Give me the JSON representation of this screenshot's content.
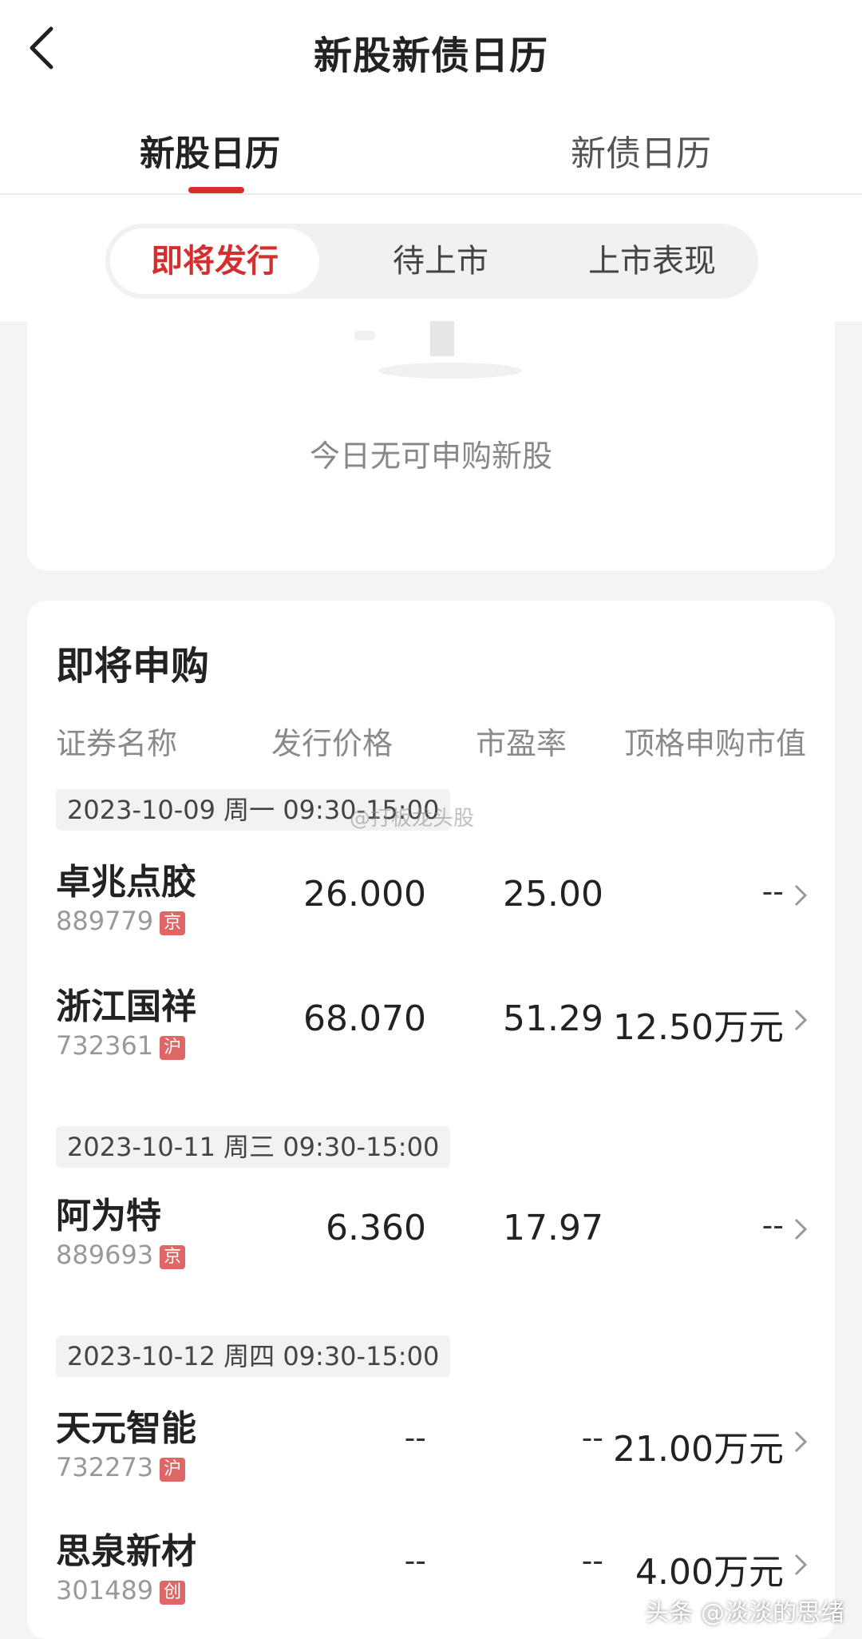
{
  "header": {
    "title": "新股新债日历"
  },
  "tabs": [
    {
      "label": "新股日历"
    },
    {
      "label": "新债日历"
    }
  ],
  "segments": [
    {
      "label": "即将发行"
    },
    {
      "label": "待上市"
    },
    {
      "label": "上市表现"
    }
  ],
  "empty": {
    "text": "今日无可申购新股"
  },
  "section": {
    "title": "即将申购",
    "columns": [
      "证券名称",
      "发行价格",
      "市盈率",
      "顶格申购市值"
    ]
  },
  "groups": [
    {
      "date": "2023-10-09 周一   09:30-15:00",
      "rows": [
        {
          "name": "卓兆点胶",
          "code": "889779",
          "market": "京",
          "price": "26.000",
          "pe": "25.00",
          "mv": "--"
        },
        {
          "name": "浙江国祥",
          "code": "732361",
          "market": "沪",
          "price": "68.070",
          "pe": "51.29",
          "mv": "12.50万元"
        }
      ]
    },
    {
      "date": "2023-10-11 周三   09:30-15:00",
      "rows": [
        {
          "name": "阿为特",
          "code": "889693",
          "market": "京",
          "price": "6.360",
          "pe": "17.97",
          "mv": "--"
        }
      ]
    },
    {
      "date": "2023-10-12 周四   09:30-15:00",
      "rows": [
        {
          "name": "天元智能",
          "code": "732273",
          "market": "沪",
          "price": "--",
          "pe": "--",
          "mv": "21.00万元"
        },
        {
          "name": "思泉新材",
          "code": "301489",
          "market": "创",
          "price": "--",
          "pe": "--",
          "mv": "4.00万元"
        }
      ]
    }
  ],
  "watermarks": {
    "center": "@打板龙头股",
    "footer": "头条 @淡淡的思绪"
  },
  "colors": {
    "accent": "#d32f2f",
    "badge": "#e06565"
  }
}
